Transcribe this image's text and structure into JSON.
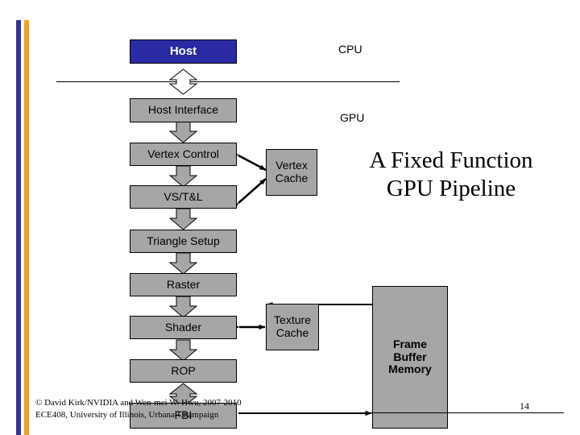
{
  "slide": {
    "title_line1": "A Fixed Function",
    "title_line2": "GPU Pipeline",
    "page_number": "14"
  },
  "regions": {
    "cpu_label": "CPU",
    "gpu_label": "GPU"
  },
  "nodes": {
    "host": "Host",
    "host_interface": "Host Interface",
    "vertex_control": "Vertex Control",
    "vs_tl": "VS/T&L",
    "triangle_setup": "Triangle Setup",
    "raster": "Raster",
    "shader": "Shader",
    "rop": "ROP",
    "fbi": "FBI",
    "vertex_cache_line1": "Vertex",
    "vertex_cache_line2": "Cache",
    "texture_cache_line1": "Texture",
    "texture_cache_line2": "Cache",
    "frame_buffer_line1": "Frame",
    "frame_buffer_line2": "Buffer",
    "frame_buffer_line3": "Memory"
  },
  "footer": {
    "line1": "© David Kirk/NVIDIA and Wen-mei W. Hwu, 2007-2010",
    "line2": "ECE408, University of Illinois, Urbana-Champaign"
  },
  "colors": {
    "host_fill": "#2a2aa5",
    "node_fill": "#a6a6a6",
    "bar_blue": "#33339a",
    "bar_gold": "#f0a020",
    "stroke": "#000000"
  }
}
